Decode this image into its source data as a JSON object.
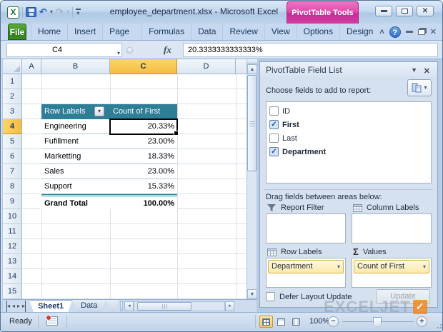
{
  "icons": {
    "dropdown": "▾",
    "up": "▲",
    "down": "▼",
    "left": "◂",
    "right": "▸",
    "undo": "↶",
    "redo": "↷",
    "close": "✕",
    "chevron": "˄",
    "help": "?",
    "sigma": "Σ",
    "check": "✓",
    "minus": "−",
    "plus": "+",
    "pane_menu": "▼",
    "excel_logo": "X"
  },
  "titlebar": {
    "title": "employee_department.xlsx - Microsoft Excel",
    "contextual_label": "PivotTable Tools"
  },
  "ribbon": {
    "tabs": [
      "File",
      "Home",
      "Insert",
      "Page Layout",
      "Formulas",
      "Data",
      "Review",
      "View",
      "Options",
      "Design"
    ]
  },
  "formula_bar": {
    "name_box": "C4",
    "fx_label": "fx",
    "value": "20.3333333333333%"
  },
  "grid": {
    "column_headers": [
      "A",
      "B",
      "C",
      "D"
    ],
    "selected_column": "C",
    "row_headers": [
      "1",
      "2",
      "3",
      "4",
      "5",
      "6",
      "7",
      "8",
      "9",
      "10",
      "11",
      "12",
      "13",
      "14",
      "15"
    ],
    "selected_row": "4",
    "selected_cell": "C4"
  },
  "pivot_table": {
    "header_bg": "#2E7E96",
    "columns": [
      "Row Labels",
      "Count of First"
    ],
    "rows": [
      {
        "label": "Engineering",
        "value": "20.33%"
      },
      {
        "label": "Fufillment",
        "value": "23.00%"
      },
      {
        "label": "Marketting",
        "value": "18.33%"
      },
      {
        "label": "Sales",
        "value": "23.00%"
      },
      {
        "label": "Support",
        "value": "15.33%"
      }
    ],
    "grand_total": {
      "label": "Grand Total",
      "value": "100.00%"
    }
  },
  "field_list": {
    "title": "PivotTable Field List",
    "choose_label": "Choose fields to add to report:",
    "fields": [
      {
        "name": "ID",
        "checked": false
      },
      {
        "name": "First",
        "checked": true
      },
      {
        "name": "Last",
        "checked": false
      },
      {
        "name": "Department",
        "checked": true
      }
    ],
    "drag_label": "Drag fields between areas below:",
    "areas": [
      {
        "label": "Report Filter",
        "items": []
      },
      {
        "label": "Column Labels",
        "items": []
      },
      {
        "label": "Row Labels",
        "items": [
          "Department"
        ]
      },
      {
        "label": "Values",
        "items": [
          "Count of First"
        ]
      }
    ],
    "defer_label": "Defer Layout Update",
    "update_label": "Update"
  },
  "sheet_bar": {
    "tabs": [
      "Sheet1",
      "Data"
    ],
    "active_tab": "Sheet1"
  },
  "status_bar": {
    "mode": "Ready",
    "zoom_level": "100%"
  },
  "watermark": {
    "text": "EXCELJET",
    "accent_color": "#F6871F"
  }
}
